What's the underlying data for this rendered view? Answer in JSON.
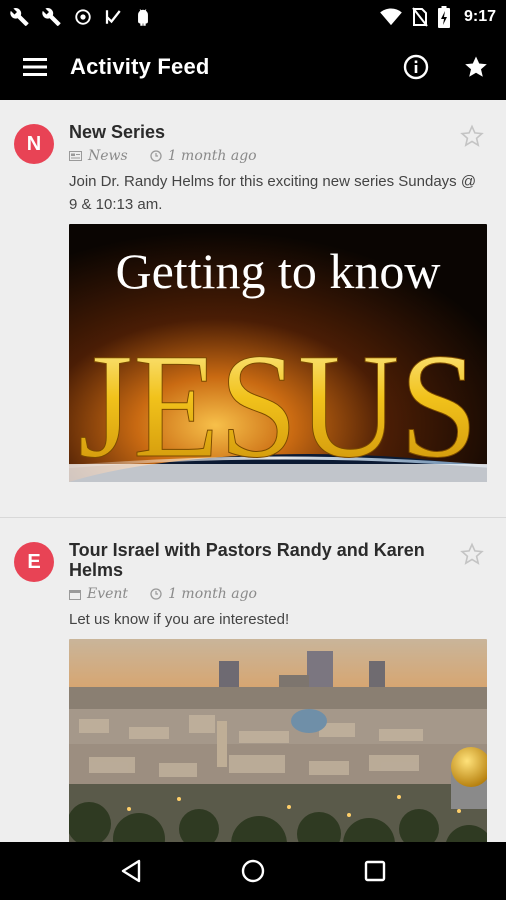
{
  "status_bar": {
    "time": "9:17",
    "left_icons": [
      "wrench-icon",
      "wrench-icon",
      "vpn-icon",
      "check-flag-icon",
      "android-icon"
    ],
    "right_icons": [
      "wifi-icon",
      "no-sim-icon",
      "battery-icon"
    ]
  },
  "app_bar": {
    "title": "Activity Feed",
    "menu_icon": "hamburger-menu-icon",
    "info_icon": "info-icon",
    "favorite_icon": "star-icon"
  },
  "feed": [
    {
      "avatar_letter": "N",
      "title": "New Series",
      "category": "News",
      "time_ago": "1 month ago",
      "description": "Join Dr. Randy Helms for this exciting new series Sundays @ 9 & 10:13 am.",
      "image_text_line1": "Getting to know",
      "image_text_line2": "JESUS"
    },
    {
      "avatar_letter": "E",
      "title": "Tour Israel with Pastors Randy and Karen Helms",
      "category": "Event",
      "time_ago": "1 month ago",
      "description": "Let us know if you are interested!"
    }
  ],
  "colors": {
    "avatar": "#e84355",
    "app_bar": "#000000",
    "background": "#eeeeee",
    "jesus_gold": "#f1c21b"
  }
}
